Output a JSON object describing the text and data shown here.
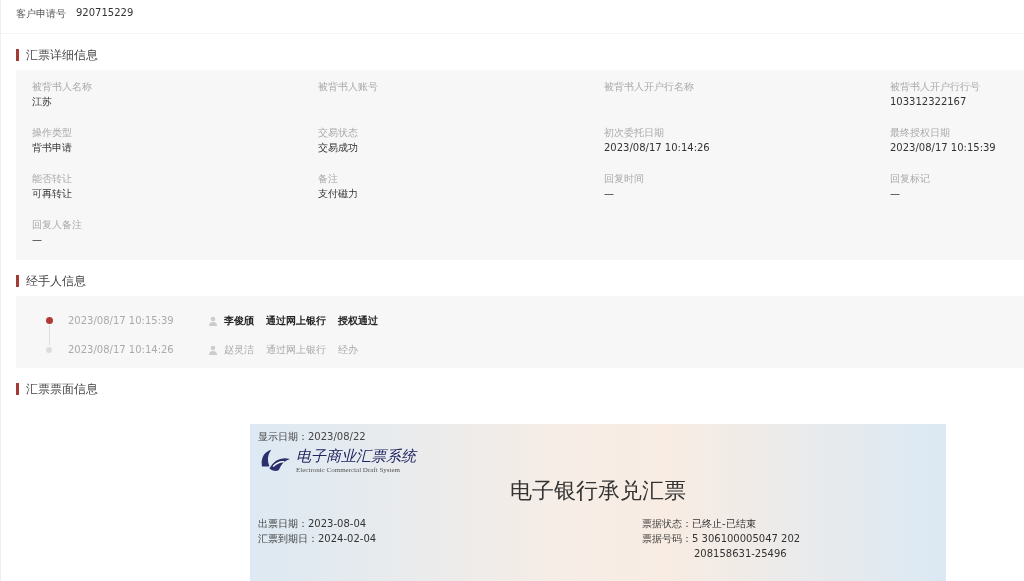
{
  "customer": {
    "label": "客户申请号",
    "value": "920715229"
  },
  "details": {
    "title": "汇票详细信息",
    "fields": [
      {
        "label": "被背书人名称",
        "value": "江苏"
      },
      {
        "label": "被背书人账号"
      },
      {
        "label": "被背书人开户行名称"
      },
      {
        "label": "被背书人开户行行号",
        "value": "103312322167"
      },
      {
        "label": "操作类型",
        "value": "背书申请"
      },
      {
        "label": "交易状态",
        "value": "交易成功"
      },
      {
        "label": "初次委托日期",
        "value": "2023/08/17 10:14:26"
      },
      {
        "label": "最终授权日期",
        "value": "2023/08/17 10:15:39"
      },
      {
        "label": "能否转让",
        "value": "可再转让"
      },
      {
        "label": "备注",
        "value": "支付磁力"
      },
      {
        "label": "回复时间",
        "value": "—"
      },
      {
        "label": "回复标记",
        "value": "—"
      },
      {
        "label": "回复人备注",
        "value": "—"
      }
    ]
  },
  "handlers": {
    "title": "经手人信息",
    "items": [
      {
        "time": "2023/08/17 10:15:39",
        "name": "李俊颀",
        "channel": "通过网上银行",
        "action": "授权通过",
        "active": true
      },
      {
        "time": "2023/08/17 10:14:26",
        "name": "赵灵洁",
        "channel": "通过网上银行",
        "action": "经办",
        "active": false
      }
    ]
  },
  "bill": {
    "title": "汇票票面信息",
    "display_date": "显示日期：2023/08/22",
    "logo_cn": "电子商业汇票系统",
    "logo_en": "Electronic Commercial Draft System",
    "heading": "电子银行承兑汇票",
    "left": [
      {
        "label": "出票日期：",
        "value": "2023-08-04"
      },
      {
        "label": "汇票到期日：",
        "value": "2024-02-04"
      }
    ],
    "right": [
      {
        "label": "票据状态：",
        "value": "已终止-已结束"
      },
      {
        "label": "票据号码：",
        "value": "5 306100005047 202"
      }
    ],
    "number_line2": "208158631-25496"
  }
}
